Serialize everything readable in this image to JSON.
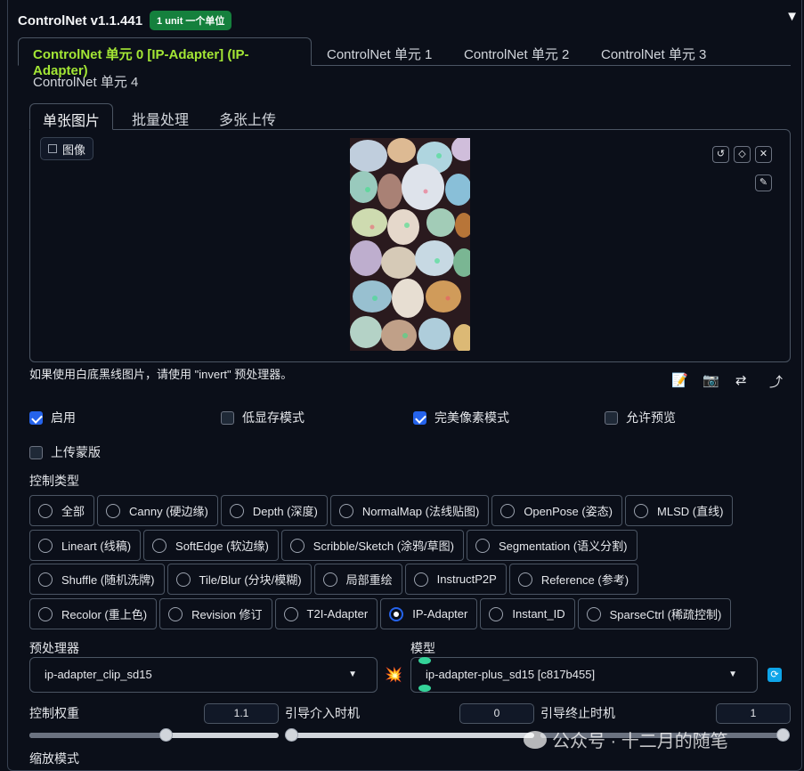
{
  "header": {
    "title": "ControlNet v1.1.441",
    "badge": "1 unit 一个单位",
    "collapse_icon": "triangle-down-icon"
  },
  "unit_tabs": [
    "ControlNet 单元 0 [IP-Adapter] (IP-Adapter)",
    "ControlNet 单元 1",
    "ControlNet 单元 2",
    "ControlNet 单元 3",
    "ControlNet 单元 4"
  ],
  "image_tabs": [
    "单张图片",
    "批量处理",
    "多张上传"
  ],
  "image_panel": {
    "label": "图像",
    "hint": "如果使用白底黑线图片，请使用 \"invert\" 预处理器。"
  },
  "checkboxes": [
    {
      "label": "启用",
      "checked": true
    },
    {
      "label": "低显存模式",
      "checked": false
    },
    {
      "label": "完美像素模式",
      "checked": true
    },
    {
      "label": "允许预览",
      "checked": false
    },
    {
      "label": "上传蒙版",
      "checked": false
    }
  ],
  "control_type": {
    "label": "控制类型",
    "selected": "IP-Adapter",
    "rows": [
      [
        "全部",
        "Canny (硬边缘)",
        "Depth (深度)",
        "NormalMap (法线贴图)",
        "OpenPose (姿态)",
        "MLSD (直线)"
      ],
      [
        "Lineart (线稿)",
        "SoftEdge (软边缘)",
        "Scribble/Sketch (涂鸦/草图)",
        "Segmentation (语义分割)"
      ],
      [
        "Shuffle (随机洗牌)",
        "Tile/Blur (分块/模糊)",
        "局部重绘",
        "InstructP2P",
        "Reference (参考)"
      ],
      [
        "Recolor (重上色)",
        "Revision 修订",
        "T2I-Adapter",
        "IP-Adapter",
        "Instant_ID",
        "SparseCtrl (稀疏控制)"
      ]
    ]
  },
  "preprocessor": {
    "label": "预处理器",
    "value": "ip-adapter_clip_sd15"
  },
  "model": {
    "label": "模型",
    "value": "ip-adapter-plus_sd15 [c817b455]"
  },
  "sliders": {
    "weight": {
      "label": "控制权重",
      "value": "1.1",
      "fraction": 0.55
    },
    "start": {
      "label": "引导介入时机",
      "value": "0",
      "fraction": 0.0
    },
    "end": {
      "label": "引导终止时机",
      "value": "1",
      "fraction": 1.0
    }
  },
  "resize_label": "缩放模式",
  "watermark": "公众号 · 十二月的随笔"
}
